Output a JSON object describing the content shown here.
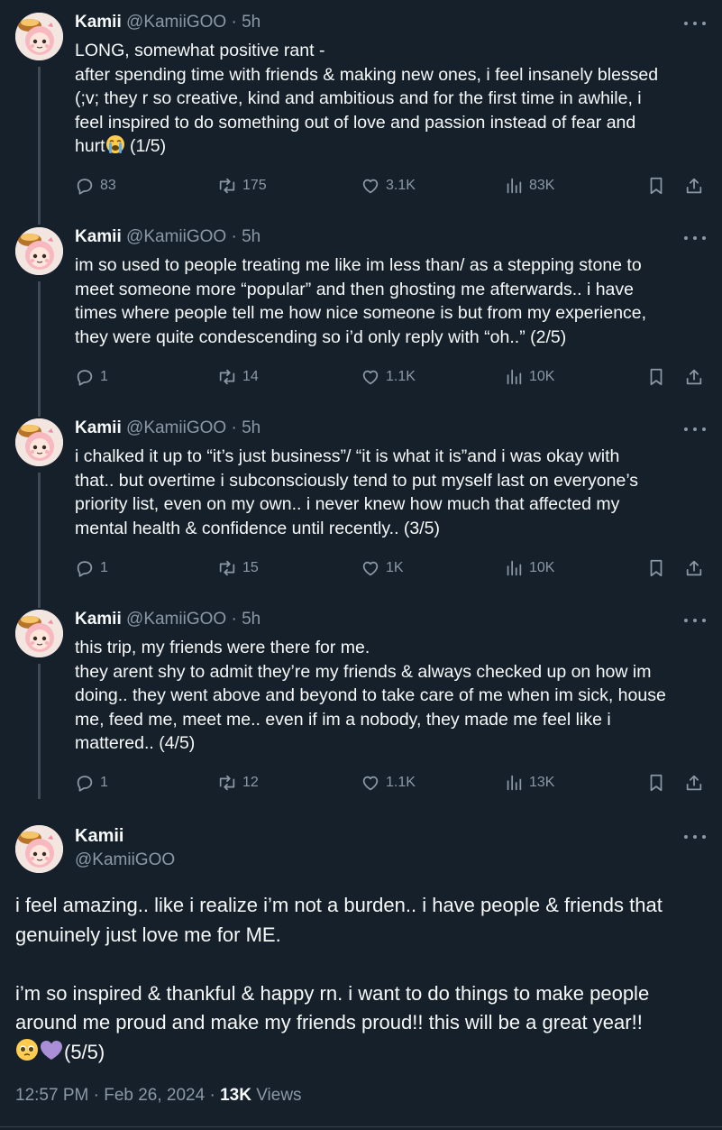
{
  "thread": [
    {
      "name": "Kamii",
      "handle": "@KamiiGOO",
      "dot": "·",
      "time": "5h",
      "lines": [
        "LONG, somewhat positive rant -",
        "after spending time with friends & making new ones, i feel insanely blessed",
        "(;v; they r so creative, kind and ambitious and for the first time in awhile, i",
        "feel inspired to do something out of love and passion instead of fear and"
      ],
      "last_line_pre": "hurt",
      "last_line_emoji": "loudly-crying-face",
      "last_line_post": " (1/5)",
      "stats": {
        "replies": "83",
        "reposts": "175",
        "likes": "3.1K",
        "views": "83K"
      }
    },
    {
      "name": "Kamii",
      "handle": "@KamiiGOO",
      "dot": "·",
      "time": "5h",
      "lines": [
        "im so used to people treating me like im less than/ as a stepping stone to",
        "meet someone more “popular” and then ghosting me afterwards.. i have",
        "times where people tell me how nice someone is but from my experience,",
        "they were quite condescending so i’d only reply with “oh..” (2/5)"
      ],
      "stats": {
        "replies": "1",
        "reposts": "14",
        "likes": "1.1K",
        "views": "10K"
      }
    },
    {
      "name": "Kamii",
      "handle": "@KamiiGOO",
      "dot": "·",
      "time": "5h",
      "lines": [
        "i chalked it up to “it’s just business”/ “it is what it is”and i was okay with",
        "that.. but overtime i subconsciously tend to put myself last on everyone’s",
        "priority list, even on my own.. i never knew how much that affected my",
        "mental health & confidence until recently.. (3/5)"
      ],
      "stats": {
        "replies": "1",
        "reposts": "15",
        "likes": "1K",
        "views": "10K"
      }
    },
    {
      "name": "Kamii",
      "handle": "@KamiiGOO",
      "dot": "·",
      "time": "5h",
      "lines": [
        "this trip, my friends were there for me.",
        "they arent shy to admit they’re my friends & always checked up on how im",
        "doing.. they went above and beyond to take care of me when im sick, house",
        "me, feed me, meet me.. even if im a nobody, they made me feel like i",
        "mattered.. (4/5)"
      ],
      "stats": {
        "replies": "1",
        "reposts": "12",
        "likes": "1.1K",
        "views": "13K"
      }
    }
  ],
  "main": {
    "name": "Kamii",
    "handle": "@KamiiGOO",
    "para1": [
      "i feel amazing.. like i realize i’m not a burden.. i have people & friends that",
      "genuinely just love me for ME."
    ],
    "para2": [
      "i’m so inspired & thankful & happy rn. i want to do things to make people",
      "around me proud and make my friends proud!! this will be a great year!!"
    ],
    "last_line_emojis": [
      "pleading-face",
      "purple-heart"
    ],
    "last_line_text": "(5/5)",
    "timestamp": "12:57 PM · Feb 26, 2024 · ",
    "views_count": "13K",
    "views_label": " Views"
  },
  "icons": {
    "reply": "reply-icon",
    "repost": "repost-icon",
    "like": "heart-icon",
    "views": "views-icon",
    "bookmark": "bookmark-icon",
    "share": "share-icon",
    "more": "more-icon"
  },
  "colors": {
    "background": "#15202b",
    "text": "#f7f9f9",
    "muted": "#8b98a5",
    "thread_line": "#3e4a56"
  }
}
